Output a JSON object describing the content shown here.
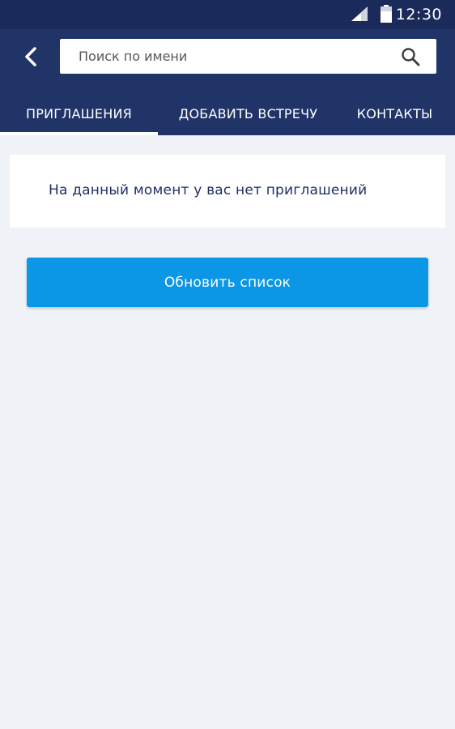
{
  "status_bar": {
    "time": "12:30",
    "icons": [
      "signal-icon",
      "battery-icon"
    ]
  },
  "header": {
    "back_icon": "back-arrow-icon",
    "search": {
      "placeholder": "Поиск по имени",
      "value": "",
      "icon": "search-icon"
    }
  },
  "tabs": [
    {
      "label": "ПРИГЛАШЕНИЯ",
      "selected": true
    },
    {
      "label": "ДОБАВИТЬ ВСТРЕЧУ",
      "selected": false
    },
    {
      "label": "КОНТАКТЫ",
      "selected": false
    }
  ],
  "main": {
    "empty_message": "На данный момент у вас нет приглашений",
    "refresh_label": "Обновить список"
  },
  "colors": {
    "status_bar": "#1a2a5a",
    "app_bar": "#213468",
    "background": "#eff2f6",
    "primary_button": "#0b96e6",
    "message_text": "#1f2f66"
  }
}
